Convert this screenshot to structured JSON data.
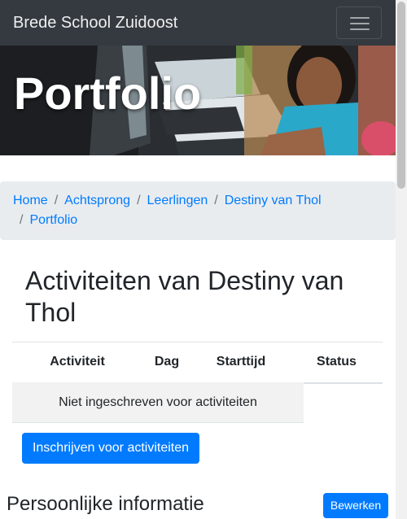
{
  "navbar": {
    "brand": "Brede School Zuidoost",
    "toggler_icon": "hamburger-menu-icon"
  },
  "hero": {
    "title": "Portfolio"
  },
  "breadcrumb": {
    "items": [
      "Home",
      "Achtsprong",
      "Leerlingen",
      "Destiny van Thol",
      "Portfolio"
    ],
    "separator": "/"
  },
  "activities": {
    "heading": "Activiteiten van Destiny van Thol",
    "columns": [
      "Activiteit",
      "Dag",
      "Starttijd",
      "Status"
    ],
    "empty_message": "Niet ingeschreven voor activiteiten",
    "enroll_button": "Inschrijven voor activiteiten"
  },
  "personal": {
    "heading": "Persoonlijke informatie",
    "edit_button": "Bewerken"
  },
  "colors": {
    "navbar_bg": "#343a40",
    "primary": "#007bff",
    "breadcrumb_bg": "#e9ecef",
    "empty_row_bg": "#f2f2f2"
  }
}
